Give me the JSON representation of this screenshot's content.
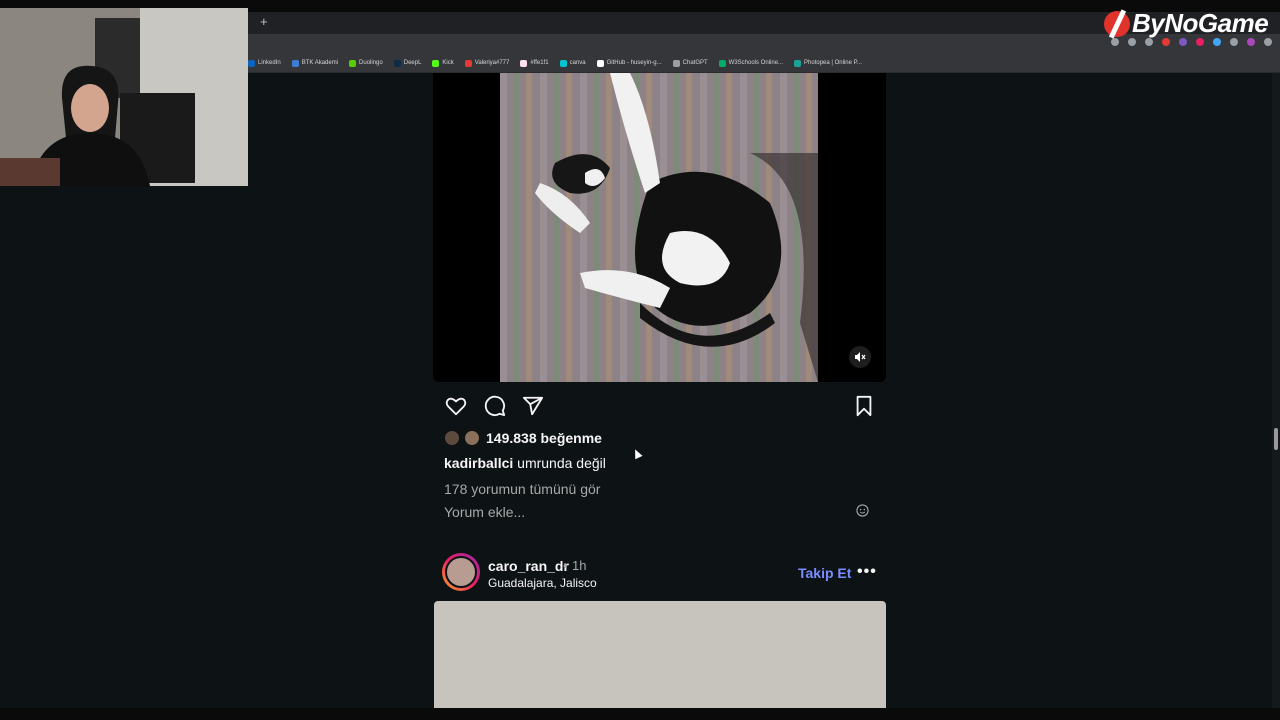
{
  "browser": {
    "new_tab": "+",
    "bookmarks": [
      {
        "label": "LinkedIn",
        "color": "#0a66c2"
      },
      {
        "label": "BTK Akademi",
        "color": "#3d7dd8"
      },
      {
        "label": "Duolingo",
        "color": "#58cc02"
      },
      {
        "label": "DeepL",
        "color": "#0f2b46"
      },
      {
        "label": "Kick",
        "color": "#53fc18"
      },
      {
        "label": "Valeriya#777",
        "color": "#e53935"
      },
      {
        "label": "#ffe1f1",
        "color": "#ffe1f1"
      },
      {
        "label": "canva",
        "color": "#00c4cc"
      },
      {
        "label": "GitHub - huseyin-g...",
        "color": "#ffffff"
      },
      {
        "label": "ChatGPT",
        "color": "#9e9e9e"
      },
      {
        "label": "W3Schools Online...",
        "color": "#04aa6d"
      },
      {
        "label": "Photopea | Online P...",
        "color": "#18a497"
      }
    ]
  },
  "watermark": {
    "text": "ByNoGame"
  },
  "post": {
    "likes": "149.838 beğenme",
    "caption_user": "kadirballci",
    "caption_text": "umrunda değil",
    "comments_link": "178 yorumun tümünü gör",
    "comment_placeholder": "Yorum ekle..."
  },
  "next_post": {
    "username": "caro_ran_dr",
    "separator": "•",
    "time": "1h",
    "location": "Guadalajara, Jalisco",
    "follow_label": "Takip Et",
    "more_label": "•••"
  },
  "colors": {
    "background": "#0d1214",
    "follow": "#7b8cff",
    "secondary_text": "#a8a8a8"
  }
}
